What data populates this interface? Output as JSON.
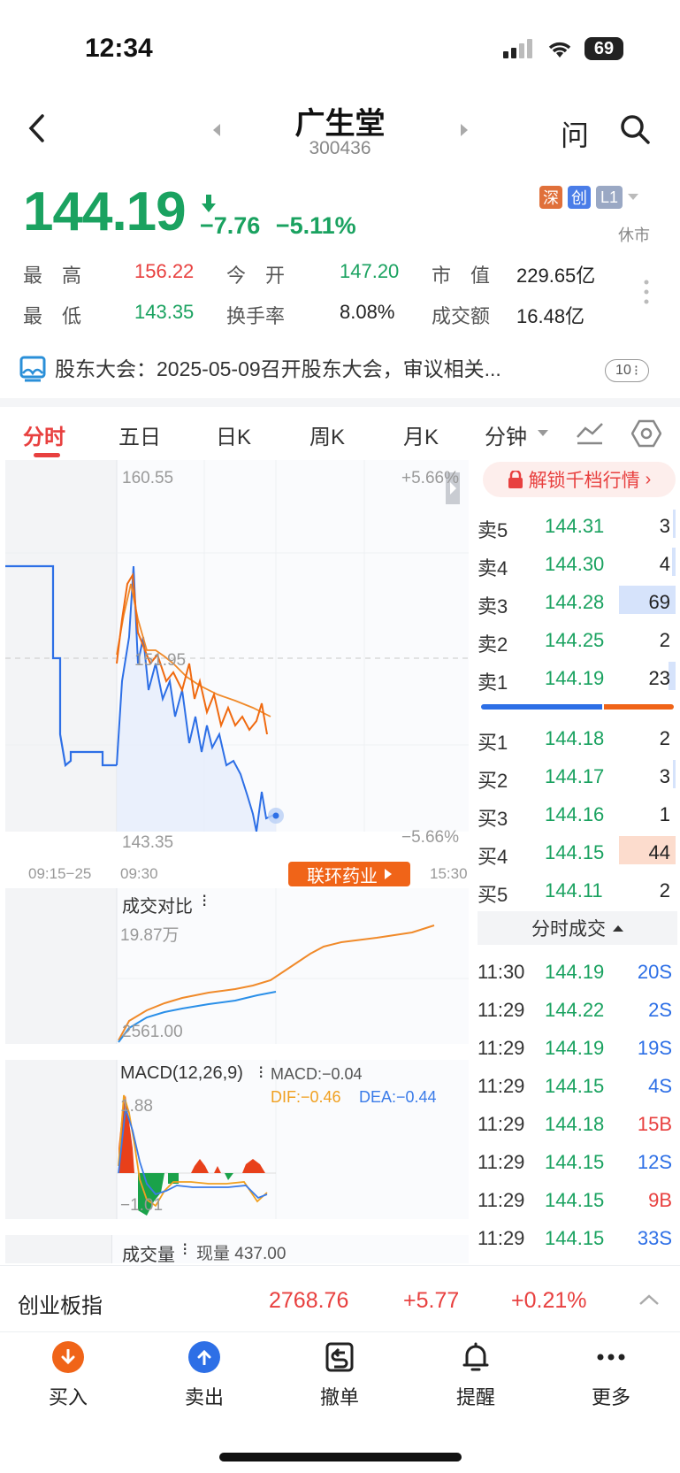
{
  "status": {
    "time": "12:34",
    "battery": "69"
  },
  "nav": {
    "title": "广生堂",
    "code": "300436",
    "ask_label": "问"
  },
  "quote": {
    "price": "144.19",
    "change": "−7.76",
    "change_pct": "−5.11%",
    "badges": [
      "深",
      "创",
      "L1"
    ],
    "market_status": "休市"
  },
  "stats": [
    {
      "label": "最　高",
      "value": "156.22",
      "color": "red"
    },
    {
      "label": "今　开",
      "value": "147.20",
      "color": "green"
    },
    {
      "label": "市　值",
      "value": "229.65亿",
      "color": "dark"
    },
    {
      "label": "最　低",
      "value": "143.35",
      "color": "green"
    },
    {
      "label": "换手率",
      "value": "8.08%",
      "color": "dark"
    },
    {
      "label": "成交额",
      "value": "16.48亿",
      "color": "dark"
    }
  ],
  "notice": {
    "text": "股东大会：2025-05-09召开股东大会，审议相关...",
    "count": "10"
  },
  "tabs": [
    "分时",
    "五日",
    "日K",
    "周K",
    "月K",
    "分钟"
  ],
  "chart": {
    "high_label": "160.55",
    "low_label": "143.35",
    "mid_label": "151.95",
    "high_pct": "+5.66%",
    "low_pct": "−5.66%",
    "time_start": "09:15−25",
    "time_open": "09:30",
    "time_close": "15:30",
    "related_tag": "联环药业"
  },
  "volume_compare": {
    "title": "成交对比",
    "top": "19.87万",
    "bottom": "2561.00"
  },
  "macd": {
    "title": "MACD(12,26,9)",
    "macd": "MACD:−0.04",
    "dif": "DIF:−0.46",
    "dea": "DEA:−0.44",
    "top": "1.88",
    "bottom": "−1.01"
  },
  "volume": {
    "title": "成交量",
    "current": "现量 437.00"
  },
  "unlock": "解锁千档行情",
  "order_book": {
    "sells": [
      {
        "label": "卖5",
        "price": "144.31",
        "vol": "3"
      },
      {
        "label": "卖4",
        "price": "144.30",
        "vol": "4"
      },
      {
        "label": "卖3",
        "price": "144.28",
        "vol": "69"
      },
      {
        "label": "卖2",
        "price": "144.25",
        "vol": "2"
      },
      {
        "label": "卖1",
        "price": "144.19",
        "vol": "23"
      }
    ],
    "buys": [
      {
        "label": "买1",
        "price": "144.18",
        "vol": "2"
      },
      {
        "label": "买2",
        "price": "144.17",
        "vol": "3"
      },
      {
        "label": "买3",
        "price": "144.16",
        "vol": "1"
      },
      {
        "label": "买4",
        "price": "144.15",
        "vol": "44"
      },
      {
        "label": "买5",
        "price": "144.11",
        "vol": "2"
      }
    ]
  },
  "trades_title": "分时成交",
  "trades": [
    {
      "time": "11:30",
      "price": "144.19",
      "vol": "20S",
      "side": "S"
    },
    {
      "time": "11:29",
      "price": "144.22",
      "vol": "2S",
      "side": "S"
    },
    {
      "time": "11:29",
      "price": "144.19",
      "vol": "19S",
      "side": "S"
    },
    {
      "time": "11:29",
      "price": "144.15",
      "vol": "4S",
      "side": "S"
    },
    {
      "time": "11:29",
      "price": "144.18",
      "vol": "15B",
      "side": "B"
    },
    {
      "time": "11:29",
      "price": "144.15",
      "vol": "12S",
      "side": "S"
    },
    {
      "time": "11:29",
      "price": "144.15",
      "vol": "9B",
      "side": "B"
    },
    {
      "time": "11:29",
      "price": "144.15",
      "vol": "33S",
      "side": "S"
    }
  ],
  "index_bar": {
    "name": "创业板指",
    "value": "2768.76",
    "change": "+5.77",
    "pct": "+0.21%"
  },
  "bottom_actions": [
    {
      "label": "买入",
      "icon": "arrow-down-icon"
    },
    {
      "label": "卖出",
      "icon": "arrow-up-icon"
    },
    {
      "label": "撤单",
      "icon": "withdraw-icon"
    },
    {
      "label": "提醒",
      "icon": "bell-icon"
    },
    {
      "label": "更多",
      "icon": "more-icon"
    }
  ]
}
